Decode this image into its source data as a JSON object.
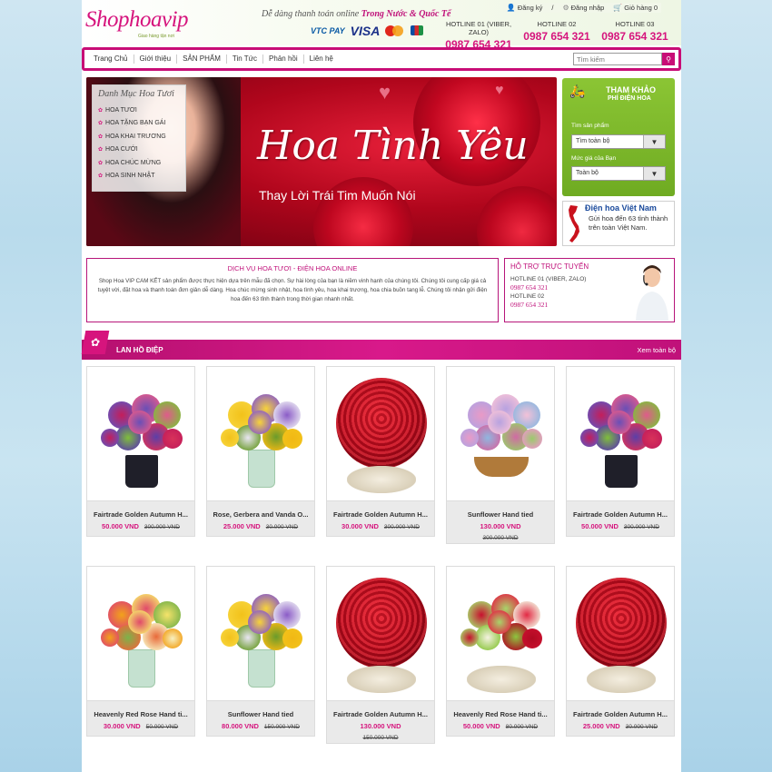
{
  "header": {
    "logo_text": "Shophoavip",
    "logo_tagline": "Giao hàng tận nơi",
    "slogan_prefix": "Dễ dàng thanh toán online",
    "slogan_highlight": "Trong Nước & Quốc Tế",
    "payments": [
      "VTC PAY",
      "VISA"
    ],
    "links": {
      "register": "Đăng ký",
      "separator": "/",
      "login": "Đăng nhập",
      "cart": "Giỏ hàng 0"
    },
    "hotlines": [
      {
        "label": "HOTLINE 01 (VIBER, ZALO)",
        "number": "0987 654 321"
      },
      {
        "label": "HOTLINE 02",
        "number": "0987 654 321"
      },
      {
        "label": "HOTLINE 03",
        "number": "0987 654 321"
      }
    ]
  },
  "nav": {
    "items": [
      "Trang Chủ",
      "Giới thiệu",
      "SẢN PHẨM",
      "Tin Tức",
      "Phản hồi",
      "Liên hệ"
    ],
    "search_placeholder": "Tìm kiếm"
  },
  "banner": {
    "title": "Hoa Tình Yêu",
    "subtitle": "Thay Lời Trái Tim Muốn Nói",
    "category_heading": "Danh Mục Hoa Tươi",
    "categories": [
      "HOA TƯƠI",
      "HOA TẶNG BẠN GÁI",
      "HOA KHAI TRƯƠNG",
      "HOA CƯỚI",
      "HOA CHÚC MỪNG",
      "HOA SINH NHẬT"
    ]
  },
  "lookup": {
    "title": "THAM KHẢO",
    "subtitle": "PHÍ ĐIỆN HOA",
    "product_label": "Tìm sản phẩm",
    "product_value": "Tìm toàn bộ",
    "price_label": "Mức giá của Bạn",
    "price_value": "Toàn bộ"
  },
  "vn_box": {
    "title": "Điện hoa Việt Nam",
    "text": "Gửi hoa đến 63 tỉnh thành trên toàn Việt Nam."
  },
  "service": {
    "heading": "DỊCH VỤ HOA TƯƠI - ĐIỆN HOA ONLINE",
    "body": "Shop Hoa VIP CAM KẾT sản phẩm được thực hiện dựa trên mẫu đã chọn. Sự hài lòng của bạn là niềm vinh hạnh của chúng tôi. Chúng tôi cung cấp giá cả tuyệt vời, đặt hoa và thanh toán đơn giản dễ dàng. Hoa chúc mừng sinh nhật, hoa tình yêu, hoa khai trương, hoa chia buồn tang lễ. Chúng tôi nhận gửi điện hoa đến 63 tỉnh thành trong thời gian nhanh nhất."
  },
  "support": {
    "heading": "HỖ TRỢ TRỰC TUYẾN",
    "line1_label": "HOTLINE 01 (VIBER, ZALO)",
    "line1_number": "0987 654 321",
    "line2_label": "HOTLINE 02",
    "line2_number": "0987 654 321"
  },
  "section": {
    "title": "LAN HỒ ĐIỆP",
    "more": "Xem toàn bộ"
  },
  "products": [
    {
      "name": "Fairtrade Golden Autumn H...",
      "price": "50.000 VND",
      "old": "300.000 VND",
      "style": "purple-vase"
    },
    {
      "name": "Rose, Gerbera and Vanda O...",
      "price": "25.000 VND",
      "old": "30.000 VND",
      "style": "sunflower"
    },
    {
      "name": "Fairtrade Golden Autumn H...",
      "price": "30.000 VND",
      "old": "300.000 VND",
      "style": "red-ball"
    },
    {
      "name": "Sunflower Hand tied",
      "price": "130.000 VND",
      "old": "300.000 VND",
      "style": "basket"
    },
    {
      "name": "Fairtrade Golden Autumn H...",
      "price": "50.000 VND",
      "old": "300.000 VND",
      "style": "purple-vase"
    },
    {
      "name": "Heavenly Red Rose Hand ti...",
      "price": "30.000 VND",
      "old": "50.000 VND",
      "style": "mixed-vase"
    },
    {
      "name": "Sunflower Hand tied",
      "price": "80.000 VND",
      "old": "150.000 VND",
      "style": "sunflower"
    },
    {
      "name": "Fairtrade Golden Autumn H...",
      "price": "130.000 VND",
      "old": "150.000 VND",
      "style": "red-ball"
    },
    {
      "name": "Heavenly Red Rose Hand ti...",
      "price": "50.000 VND",
      "old": "80.000 VND",
      "style": "red-green"
    },
    {
      "name": "Fairtrade Golden Autumn H...",
      "price": "25.000 VND",
      "old": "30.000 VND",
      "style": "red-ball"
    }
  ]
}
